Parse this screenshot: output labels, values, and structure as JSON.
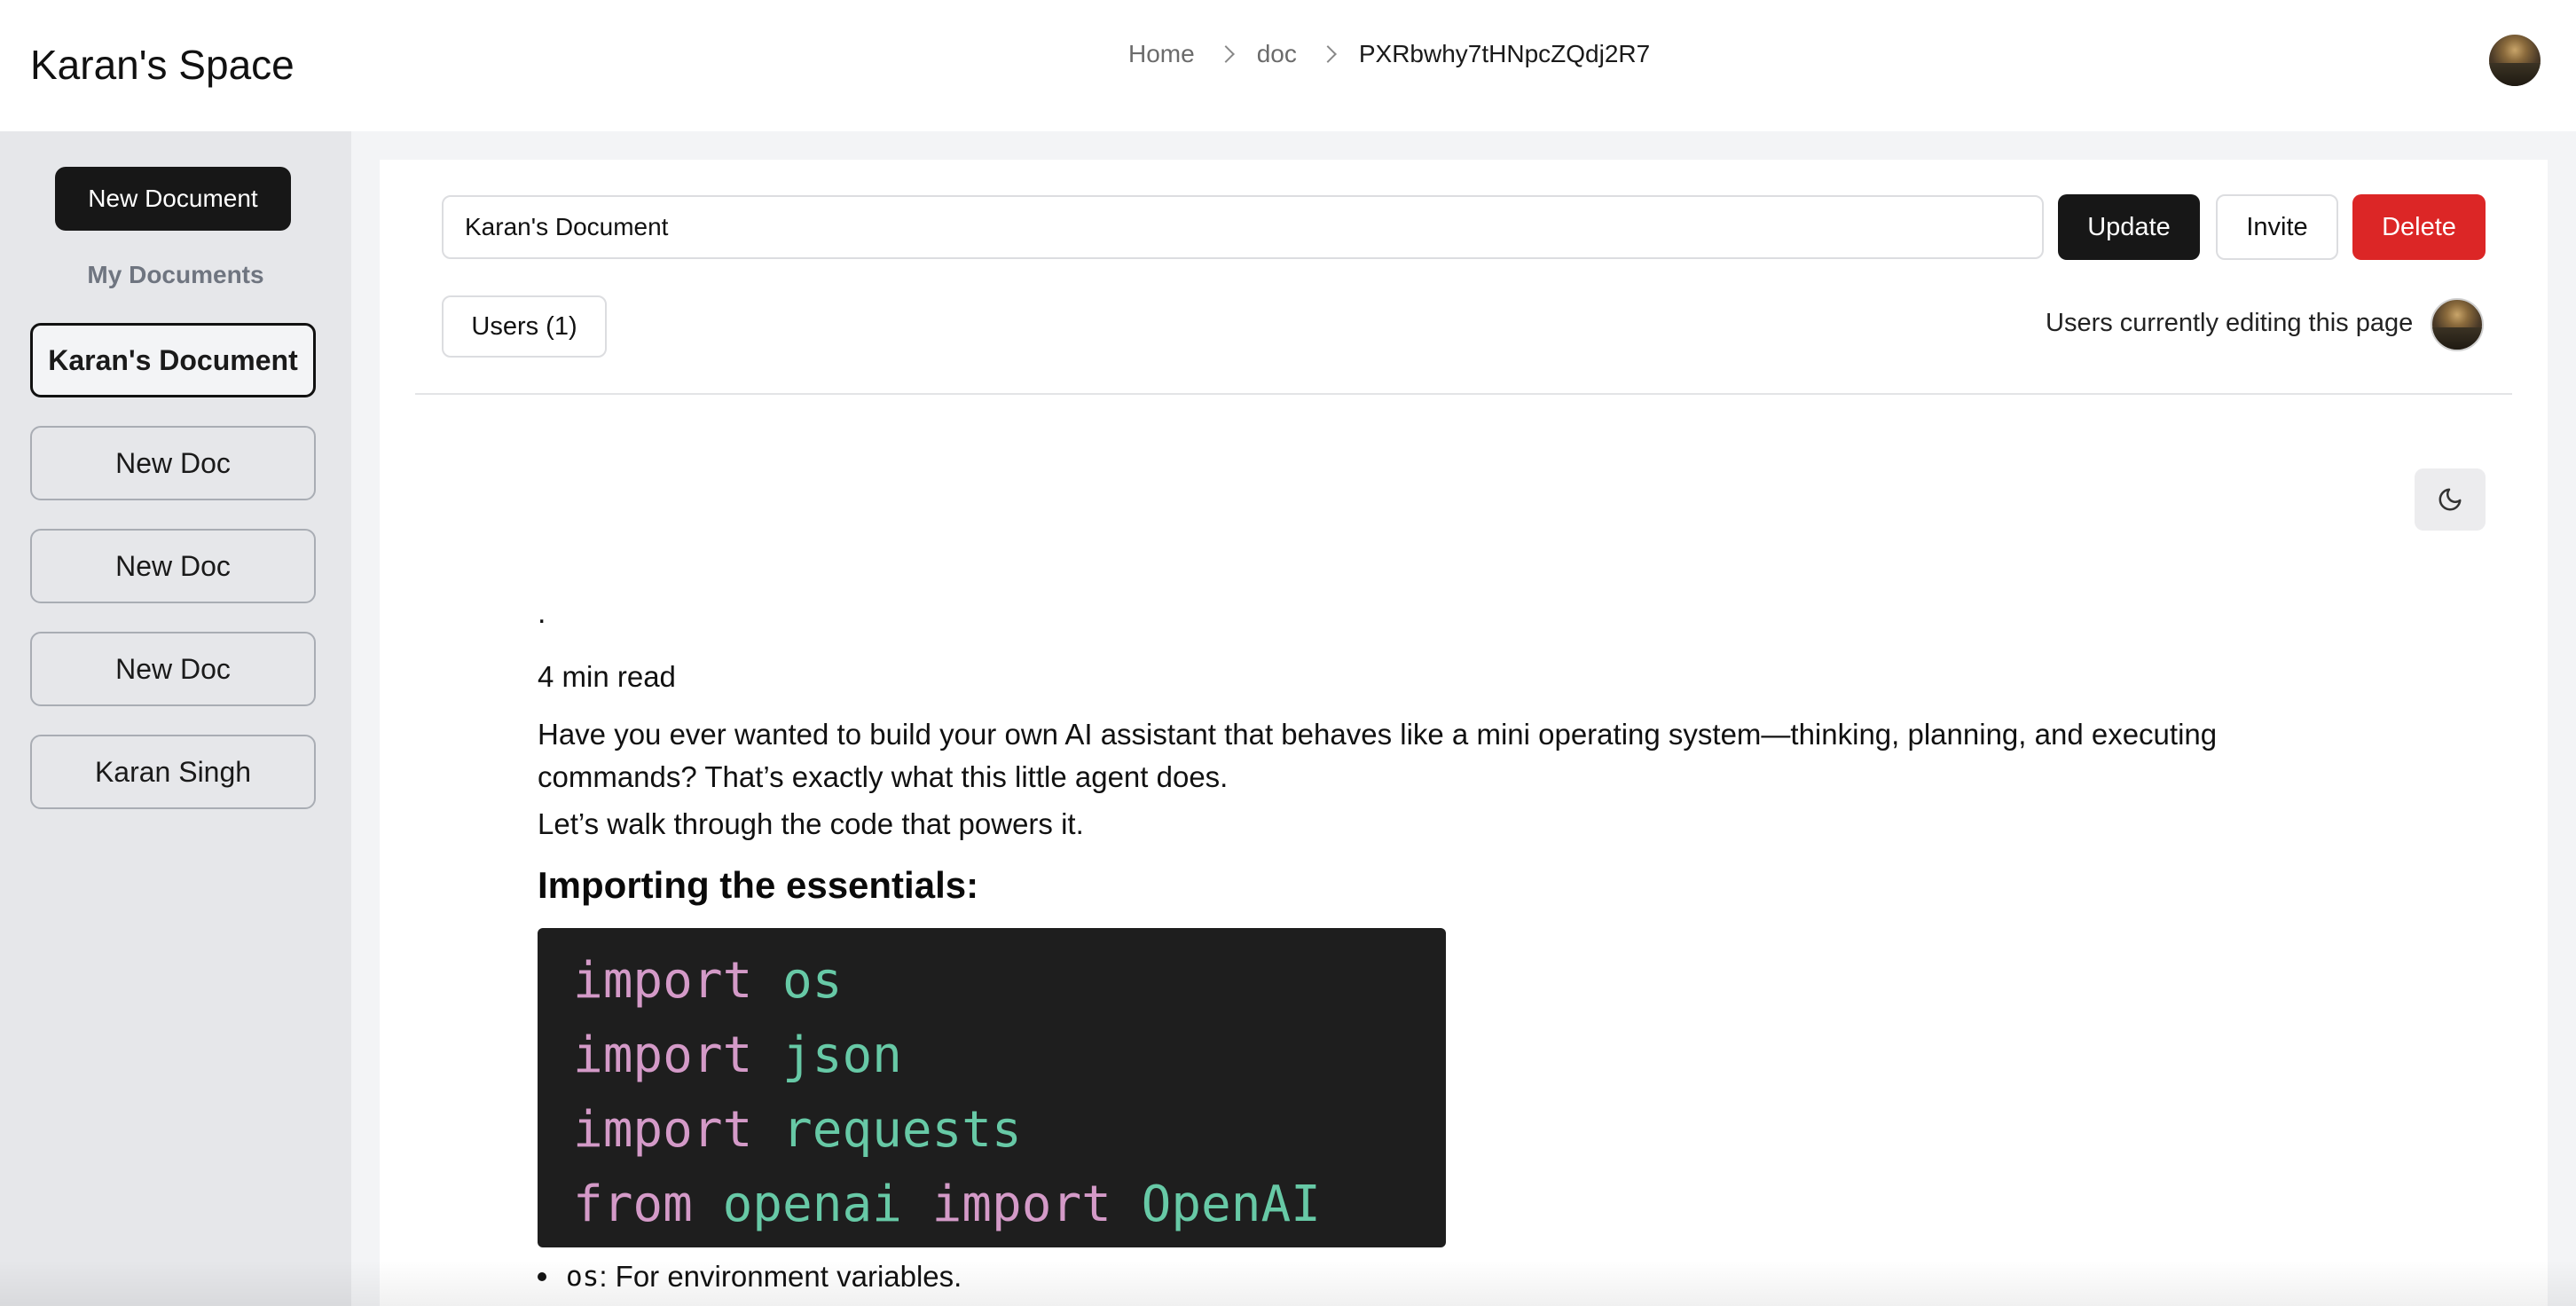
{
  "app": {
    "brand": "Karan's Space"
  },
  "breadcrumb": {
    "items": [
      "Home",
      "doc",
      "PXRbwhy7tHNpcZQdj2R7"
    ]
  },
  "sidebar": {
    "new_document_label": "New Document",
    "heading": "My Documents",
    "documents": [
      {
        "label": "Karan's Document",
        "active": true
      },
      {
        "label": "New Doc",
        "active": false
      },
      {
        "label": "New Doc",
        "active": false
      },
      {
        "label": "New Doc",
        "active": false
      },
      {
        "label": "Karan Singh",
        "active": false
      }
    ]
  },
  "toolbar": {
    "title_value": "Karan's Document",
    "update_label": "Update",
    "invite_label": "Invite",
    "delete_label": "Delete",
    "users_label": "Users (1)",
    "editing_label": "Users currently editing this page"
  },
  "icons": {
    "theme_toggle": "moon-icon",
    "breadcrumb_separator": "chevron-right-icon"
  },
  "colors": {
    "primary_button": "#171717",
    "delete_button": "#dc2626",
    "sidebar_bg": "#e6e7ea",
    "code_bg": "#1e1e1e"
  },
  "article": {
    "dot": ".",
    "read_time": "4 min read",
    "paragraph1": "Have you ever wanted to build your own AI assistant that behaves like a mini operating system—thinking, planning, and executing commands? That’s exactly what this little agent does.",
    "paragraph2": "Let’s walk through the code that powers it.",
    "heading": "Importing the essentials:",
    "code": [
      {
        "kw": "import",
        "id": "os",
        "kw2": "",
        "id2": ""
      },
      {
        "kw": "import",
        "id": "json",
        "kw2": "",
        "id2": ""
      },
      {
        "kw": "import",
        "id": "requests",
        "kw2": "",
        "id2": ""
      },
      {
        "kw": "from",
        "id": "openai",
        "kw2": "import",
        "id2": "OpenAI"
      }
    ],
    "bullet_code": "os",
    "bullet_text": ": For environment variables."
  }
}
